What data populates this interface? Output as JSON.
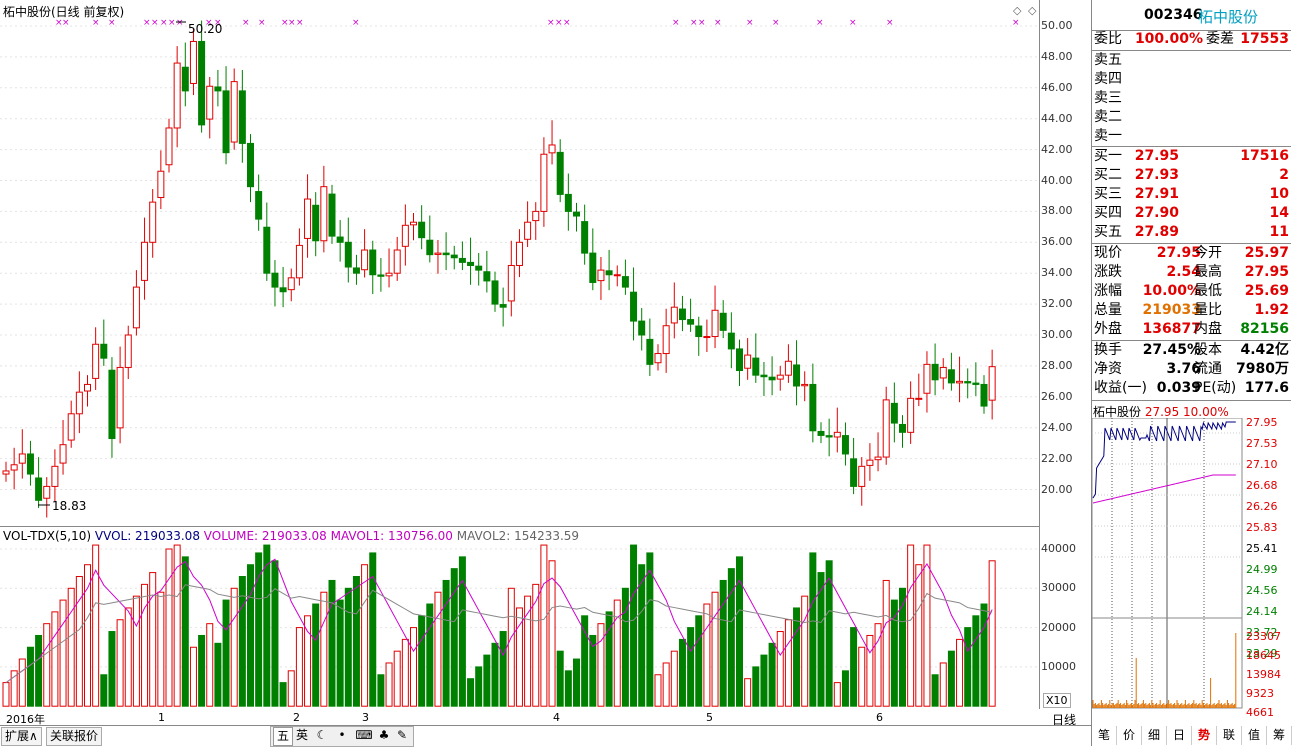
{
  "chart_title": "柘中股份(日线 前复权)",
  "price_high_label": "50.20",
  "price_low_label": "18.83",
  "y_axis": [
    "50.00",
    "48.00",
    "46.00",
    "44.00",
    "42.00",
    "40.00",
    "38.00",
    "36.00",
    "34.00",
    "32.00",
    "30.00",
    "28.00",
    "26.00",
    "24.00",
    "22.00",
    "20.00"
  ],
  "volume_indicator": {
    "name": "VOL-TDX(5,10)",
    "vvol": "VVOL: 219033.08",
    "volume": "VOLUME: 219033.08",
    "mavol1": "MAVOL1: 130756.00",
    "mavol2": "MAVOL2: 154233.59"
  },
  "vol_y_axis": [
    "40000",
    "30000",
    "20000",
    "10000"
  ],
  "vol_unit": "X10",
  "date_ticks": [
    "2016年",
    "1",
    "2",
    "3",
    "4",
    "5",
    "6"
  ],
  "period_label": "日线",
  "bottom_tabs": [
    "扩展∧",
    "关联报价"
  ],
  "toolbar_icons": [
    "五",
    "英",
    "moon-icon",
    "dot-icon",
    "keyboard-icon",
    "shirt-icon",
    "wrench-icon"
  ],
  "stock": {
    "code": "002346",
    "name": "柘中股份"
  },
  "order_book": {
    "ratio_label": "委比",
    "ratio": "100.00%",
    "diff_label": "委差",
    "diff": "17553",
    "sells": [
      {
        "label": "卖五"
      },
      {
        "label": "卖四"
      },
      {
        "label": "卖三"
      },
      {
        "label": "卖二"
      },
      {
        "label": "卖一"
      }
    ],
    "buys": [
      {
        "label": "买一",
        "price": "27.95",
        "vol": "17516"
      },
      {
        "label": "买二",
        "price": "27.93",
        "vol": "2"
      },
      {
        "label": "买三",
        "price": "27.91",
        "vol": "10"
      },
      {
        "label": "买四",
        "price": "27.90",
        "vol": "14"
      },
      {
        "label": "买五",
        "price": "27.89",
        "vol": "11"
      }
    ]
  },
  "quote": [
    {
      "l1": "现价",
      "v1": "27.95",
      "l2": "今开",
      "v2": "25.97",
      "c1": "red",
      "c2": "red"
    },
    {
      "l1": "涨跌",
      "v1": "2.54",
      "l2": "最高",
      "v2": "27.95",
      "c1": "red",
      "c2": "red"
    },
    {
      "l1": "涨幅",
      "v1": "10.00%",
      "l2": "最低",
      "v2": "25.69",
      "c1": "red",
      "c2": "red"
    },
    {
      "l1": "总量",
      "v1": "219033",
      "l2": "量比",
      "v2": "1.92",
      "c1": "orange",
      "c2": "red"
    },
    {
      "l1": "外盘",
      "v1": "136877",
      "l2": "内盘",
      "v2": "82156",
      "c1": "red",
      "c2": "green"
    }
  ],
  "fundamentals": [
    {
      "l1": "换手",
      "v1": "27.45%",
      "l2": "股本",
      "v2": "4.42亿"
    },
    {
      "l1": "净资",
      "v1": "3.76",
      "l2": "流通",
      "v2": "7980万"
    },
    {
      "l1": "收益(一)",
      "v1": "0.039",
      "l2": "PE(动)",
      "v2": "177.6"
    }
  ],
  "mini_chart": {
    "title": "柘中股份",
    "price": "27.95",
    "pct": "10.00%",
    "price_axis": [
      "27.95",
      "27.53",
      "27.10",
      "26.68",
      "26.26",
      "25.83",
      "25.41",
      "24.99",
      "24.56",
      "24.14",
      "23.72",
      "23.29"
    ],
    "vol_axis": [
      "23307",
      "18645",
      "13984",
      "9323",
      "4661"
    ]
  },
  "right_tabs": [
    "笔",
    "价",
    "细",
    "日",
    "势",
    "联",
    "值",
    "筹"
  ],
  "active_right_tab": "势"
}
